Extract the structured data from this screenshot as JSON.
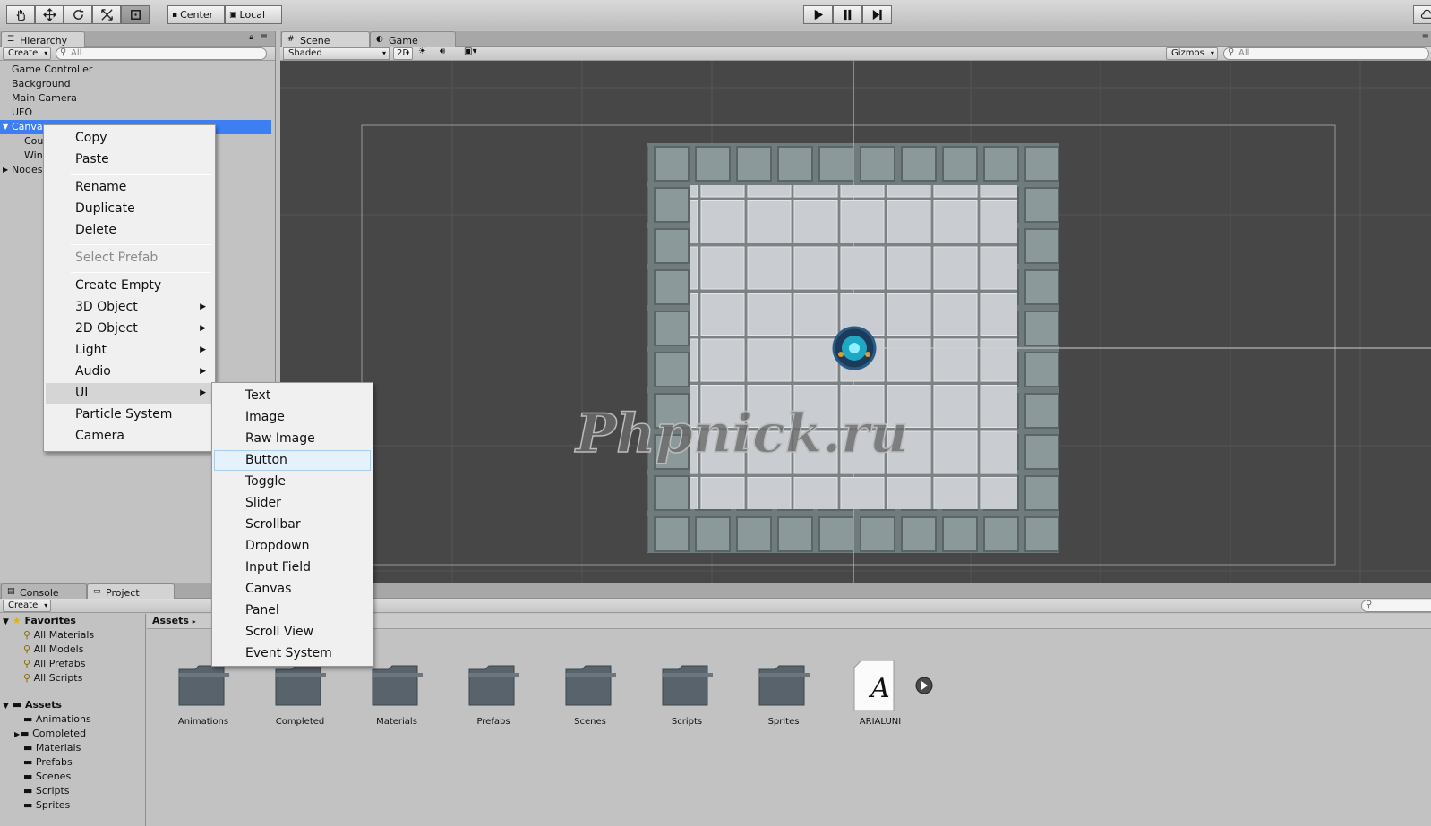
{
  "toolbar": {
    "pivot_center_label": "Center",
    "pivot_local_label": "Local",
    "tools": [
      "hand-tool",
      "move-tool",
      "rotate-tool",
      "scale-tool",
      "rect-tool"
    ]
  },
  "hierarchy": {
    "tab_label": "Hierarchy",
    "create_label": "Create",
    "search_placeholder": "All",
    "items": [
      "Game Controller",
      "Background",
      "Main Camera",
      "UFO",
      "Canvas",
      "Cou",
      "Win",
      "Nodes"
    ]
  },
  "scene": {
    "tab_scene": "Scene",
    "tab_game": "Game",
    "shading_mode": "Shaded",
    "mode_2d": "2D",
    "gizmos_label": "Gizmos",
    "search_placeholder": "All",
    "watermark": "Phpnick.ru"
  },
  "context_menu": {
    "items": [
      "Copy",
      "Paste",
      "Rename",
      "Duplicate",
      "Delete",
      "Select Prefab",
      "Create Empty",
      "3D Object",
      "2D Object",
      "Light",
      "Audio",
      "UI",
      "Particle System",
      "Camera"
    ]
  },
  "ui_submenu": {
    "items": [
      "Text",
      "Image",
      "Raw Image",
      "Button",
      "Toggle",
      "Slider",
      "Scrollbar",
      "Dropdown",
      "Input Field",
      "Canvas",
      "Panel",
      "Scroll View",
      "Event System"
    ]
  },
  "bottom": {
    "tab_console": "Console",
    "tab_project": "Project",
    "create_label": "Create",
    "favorites_title": "Favorites",
    "favorites": [
      "All Materials",
      "All Models",
      "All Prefabs",
      "All Scripts"
    ],
    "assets_title": "Assets",
    "asset_folders": [
      "Animations",
      "Completed",
      "Materials",
      "Prefabs",
      "Scenes",
      "Scripts",
      "Sprites"
    ],
    "breadcrumb": "Assets",
    "grid_items": [
      "Animations",
      "Completed",
      "Materials",
      "Prefabs",
      "Scenes",
      "Scripts",
      "Sprites",
      "ARIALUNI"
    ],
    "font_glyph": "A"
  },
  "colors": {
    "selection": "#3d7ef2",
    "scene_bg": "#474747",
    "menu_bg": "#f0f0f0"
  }
}
